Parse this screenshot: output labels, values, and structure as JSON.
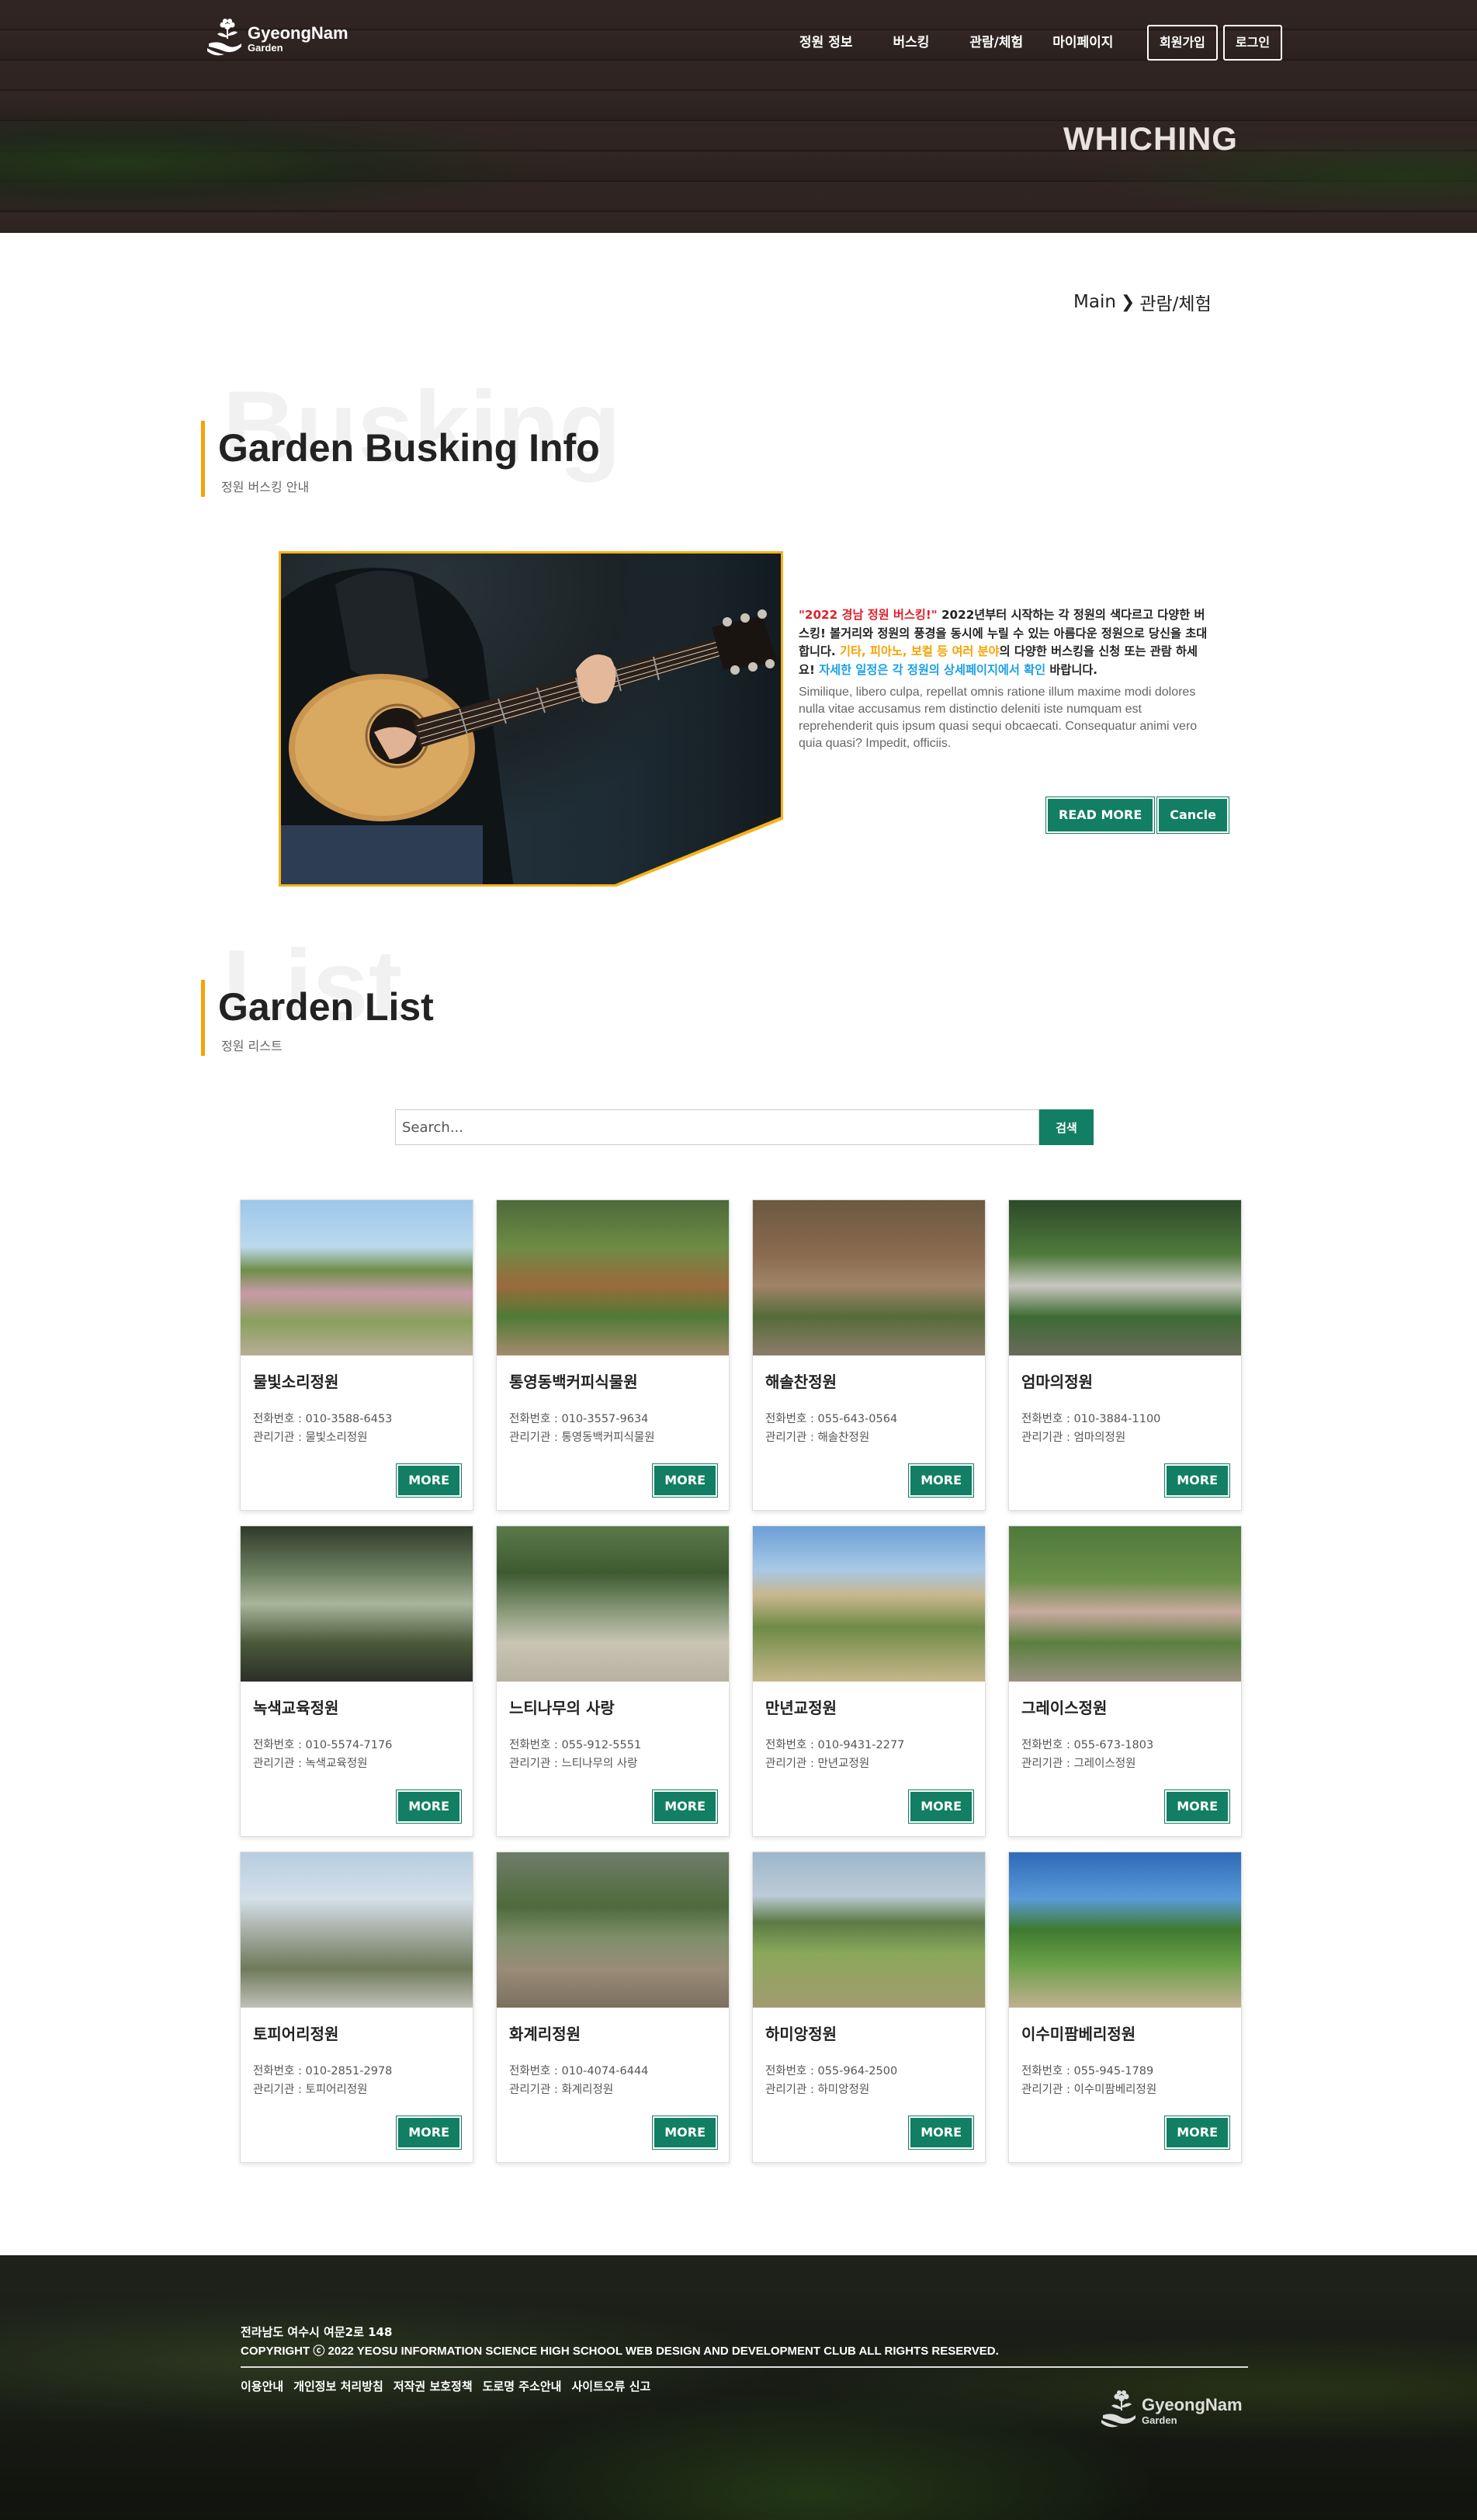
{
  "header": {
    "logo_title": "GyeongNam",
    "logo_sub": "Garden",
    "nav": [
      "정원 정보",
      "버스킹",
      "관람/체험",
      "마이페이지"
    ],
    "signup_label": "회원가입",
    "login_label": "로그인",
    "hero_word": "WHICHING"
  },
  "breadcrumb": {
    "home": "Main",
    "current": "관람/체험"
  },
  "busking": {
    "ghost": "Busking",
    "title": "Garden Busking Info",
    "subtitle": "정원 버스킹 안내",
    "highlight_red": "\"2022 경남 정원 버스킹!\"",
    "text_1": " 2022년부터 시작하는 각 정원의 색다르고 다양한 버스킹! 볼거리와 정원의 풍경을 동시에 누릴 수 있는 아름다운 정원으로 당신을 초대합니다. ",
    "highlight_orange": "기타, 피아노, 보컬 등 여러 분야",
    "text_2": "의 다양한 버스킹을 신청 또는 관람 하세요! ",
    "highlight_blue": "자세한 일정은 각 정원의 상세페이지에서 확인",
    "text_3": " 바랍니다.",
    "lorem": "Similique, libero culpa, repellat omnis ratione illum maxime modi dolores nulla vitae accusamus rem distinctio deleniti iste numquam est reprehenderit quis ipsum quasi sequi obcaecati. Consequatur animi vero quia quasi? Impedit, officiis.",
    "read_more": "READ MORE",
    "cancel": "Cancle"
  },
  "list": {
    "ghost": "List",
    "title": "Garden List",
    "subtitle": "정원 리스트",
    "search_placeholder": "Search...",
    "search_button": "검색",
    "phone_label": "전화번호 : ",
    "org_label": "관리기관 : ",
    "more_label": "MORE",
    "gardens": [
      {
        "name": "물빛소리정원",
        "phone": "010-3588-6453",
        "org": "물빛소리정원"
      },
      {
        "name": "통영동백커피식물원",
        "phone": "010-3557-9634",
        "org": "통영동백커피식물원"
      },
      {
        "name": "해솔찬정원",
        "phone": "055-643-0564",
        "org": "해솔찬정원"
      },
      {
        "name": "엄마의정원",
        "phone": "010-3884-1100",
        "org": "엄마의정원"
      },
      {
        "name": "녹색교육정원",
        "phone": "010-5574-7176",
        "org": "녹색교육정원"
      },
      {
        "name": "느티나무의 사랑",
        "phone": "055-912-5551",
        "org": "느티나무의 사랑"
      },
      {
        "name": "만년교정원",
        "phone": "010-9431-2277",
        "org": "만년교정원"
      },
      {
        "name": "그레이스정원",
        "phone": "055-673-1803",
        "org": "그레이스정원"
      },
      {
        "name": "토피어리정원",
        "phone": "010-2851-2978",
        "org": "토피어리정원"
      },
      {
        "name": "화계리정원",
        "phone": "010-4074-6444",
        "org": "화계리정원"
      },
      {
        "name": "하미앙정원",
        "phone": "055-964-2500",
        "org": "하미앙정원"
      },
      {
        "name": "이수미팜베리정원",
        "phone": "055-945-1789",
        "org": "이수미팜베리정원"
      }
    ]
  },
  "footer": {
    "address": "전라남도 여수시 여문2로 148",
    "copyright": "COPYRIGHT ⓒ 2022 YEOSU INFORMATION SCIENCE HIGH SCHOOL WEB DESIGN AND DEVELOPMENT CLUB ALL RIGHTS RESERVED.",
    "links": [
      "이용안내",
      "개인정보 처리방침",
      "저작권 보호정책",
      "도로명 주소안내",
      "사이트오류 신고"
    ],
    "logo_title": "GyeongNam",
    "logo_sub": "Garden"
  },
  "colors": {
    "accent_green": "#127e63",
    "accent_orange": "#f6a300",
    "highlight_red": "#e0202a",
    "highlight_blue": "#1aa0e6"
  }
}
